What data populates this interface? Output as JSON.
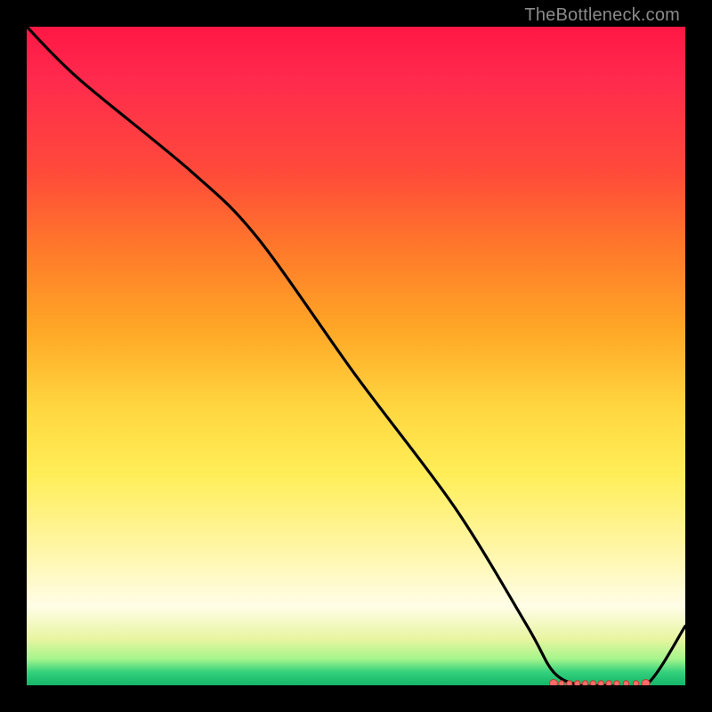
{
  "attribution": "TheBottleneck.com",
  "colors": {
    "frame": "#000000",
    "gradient_top": "#ff1744",
    "gradient_mid_orange": "#ffa726",
    "gradient_mid_yellow": "#ffee58",
    "gradient_pale": "#fffde7",
    "gradient_green": "#14b56a",
    "curve": "#000000",
    "marker_fill": "#ff6b6b",
    "marker_stroke": "#c0392b",
    "attribution_text": "#8a8a8a"
  },
  "chart_data": {
    "type": "line",
    "title": "",
    "xlabel": "",
    "ylabel": "",
    "xlim": [
      0,
      100
    ],
    "ylim": [
      0,
      100
    ],
    "grid": false,
    "legend": false,
    "series": [
      {
        "name": "curve",
        "x": [
          0,
          8,
          25,
          35,
          50,
          65,
          76,
          80,
          84,
          88,
          94,
          100
        ],
        "y": [
          100,
          92,
          78,
          68,
          47,
          27,
          9,
          2,
          0,
          0,
          0,
          9
        ]
      }
    ],
    "markers": {
      "name": "baseline-markers",
      "x": [
        80,
        81.2,
        82.4,
        83.6,
        84.8,
        86.0,
        87.2,
        88.4,
        89.6,
        91.0,
        92.5,
        94.0
      ],
      "y": [
        0,
        0,
        0,
        0,
        0,
        0,
        0,
        0,
        0,
        0,
        0,
        0
      ]
    }
  }
}
